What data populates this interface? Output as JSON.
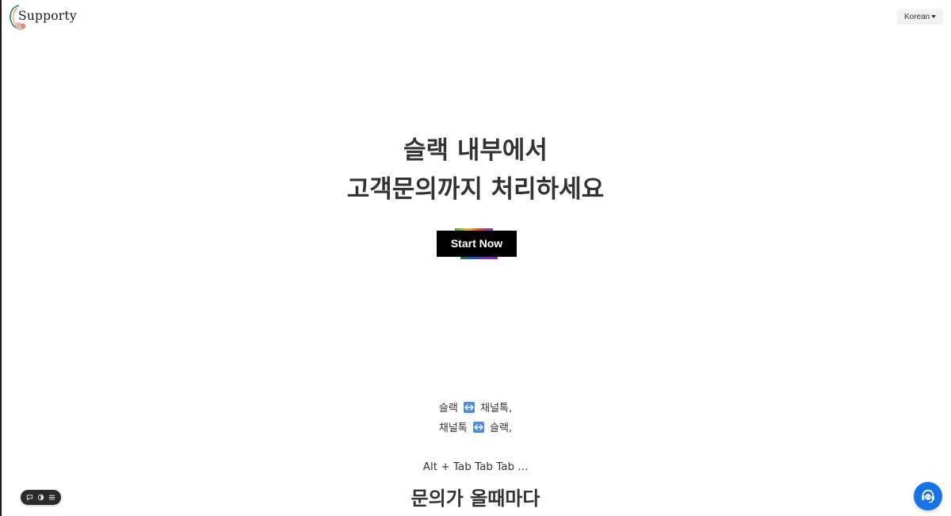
{
  "header": {
    "logo_text": "Supporty",
    "language_select": {
      "selected": "Korean"
    }
  },
  "hero": {
    "line1": "슬랙 내부에서",
    "line2": "고객문의까지 처리하세요",
    "cta_label": "Start Now"
  },
  "features": {
    "line1_left": "슬랙",
    "line1_right": "채널톡,",
    "line2_left": "채널톡",
    "line2_right": "슬랙,",
    "shortcut_text": "Alt + Tab Tab Tab ...",
    "headline": "문의가 올때마다"
  },
  "widgets": {
    "toolbar_icons": [
      "chat-bubble-icon",
      "moon-icon",
      "list-icon"
    ],
    "support_fab_icon": "headset-chat-icon"
  },
  "colors": {
    "brand_blue": "#1772e8",
    "cta_background": "#000000",
    "arrow_icon_blue": "#4a8cdf"
  }
}
